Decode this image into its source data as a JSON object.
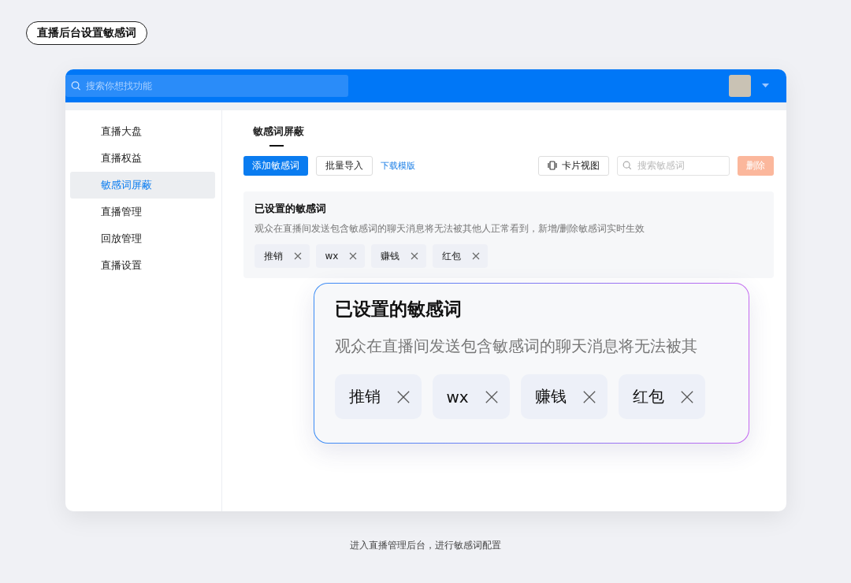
{
  "page_title": "直播后台设置敏感词",
  "topbar": {
    "search": {
      "placeholder": "搜索你想找功能"
    }
  },
  "sidebar": {
    "items": [
      {
        "label": "直播大盘",
        "selected": false
      },
      {
        "label": "直播权益",
        "selected": false
      },
      {
        "label": "敏感词屏蔽",
        "selected": true
      },
      {
        "label": "直播管理",
        "selected": false
      },
      {
        "label": "回放管理",
        "selected": false
      },
      {
        "label": "直播设置",
        "selected": false
      }
    ]
  },
  "tabs": [
    {
      "label": "敏感词屏蔽",
      "selected": true
    }
  ],
  "toolbar": {
    "add_button": "添加敏感词",
    "import_button": "批量导入",
    "download_link": "下载模版",
    "card_view_button": "卡片视图",
    "search": {
      "placeholder": "搜索敏感词"
    },
    "delete_button": {
      "label": "删除",
      "disabled": true
    }
  },
  "word_panel": {
    "title": "已设置的敏感词",
    "description": "观众在直播间发送包含敏感词的聊天消息将无法被其他人正常看到，新增/删除敏感词实时生效",
    "tags": [
      "推销",
      "wx",
      "赚钱",
      "红包"
    ]
  },
  "zoom_callout": {
    "title": "已设置的敏感词",
    "description": "观众在直播间发送包含敏感词的聊天消息将无法被其",
    "tags": [
      "推销",
      "wx",
      "赚钱",
      "红包"
    ]
  },
  "caption": "进入直播管理后台，进行敏感词配置"
}
